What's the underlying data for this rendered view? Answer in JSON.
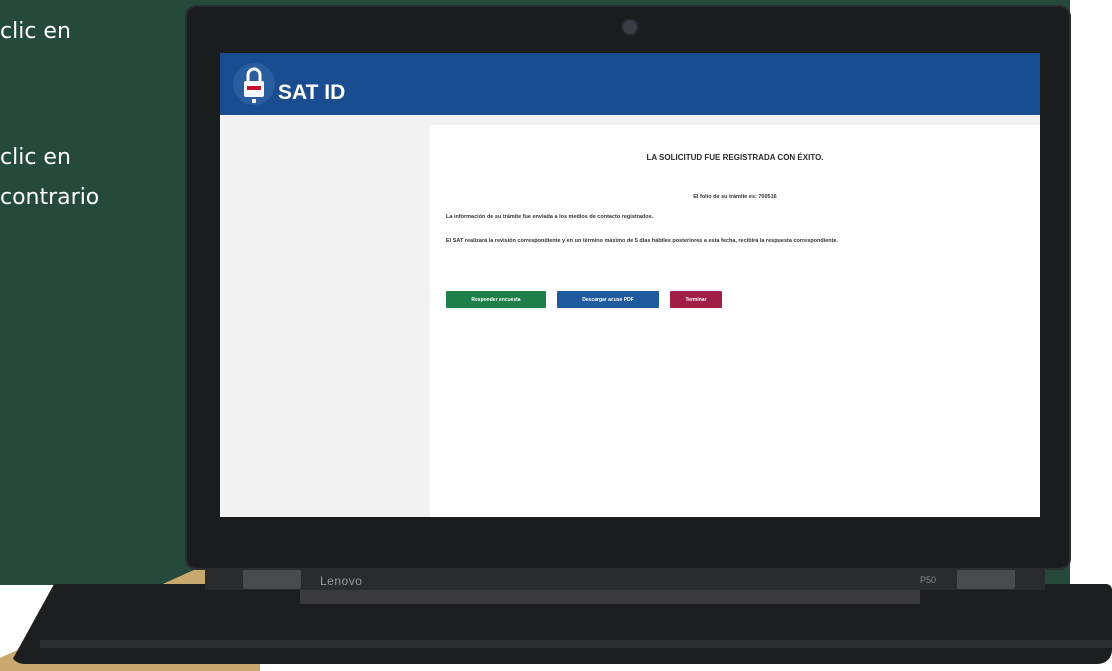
{
  "background": {
    "green": "#254a3b",
    "tan": "#c9a96e",
    "side_text": [
      "clic en",
      "clic en",
      "contrario"
    ]
  },
  "laptop": {
    "brand": "Lenovo",
    "model": "P50"
  },
  "app": {
    "title": "SAT ID",
    "header_color": "#1a4d8f",
    "logo_icon": "lock-icon"
  },
  "result": {
    "title": "LA SOLICITUD FUE REGISTRADA CON ÉXITO.",
    "folio": "El folio de su trámite es: 700516",
    "info_sent": "La información de su trámite fue enviada a los medios de contacto registrados.",
    "review_notice": "El SAT realizará la revisión correspondiente y en un término máximo de 5 días hábiles posteriores a esta fecha, recibirá la respuesta correspondiente."
  },
  "buttons": {
    "survey": "Responder encuesta",
    "download": "Descargar acuse PDF",
    "finish": "Terminar",
    "colors": {
      "survey": "#1e8048",
      "download": "#1f5a9e",
      "finish": "#a11f47"
    }
  }
}
